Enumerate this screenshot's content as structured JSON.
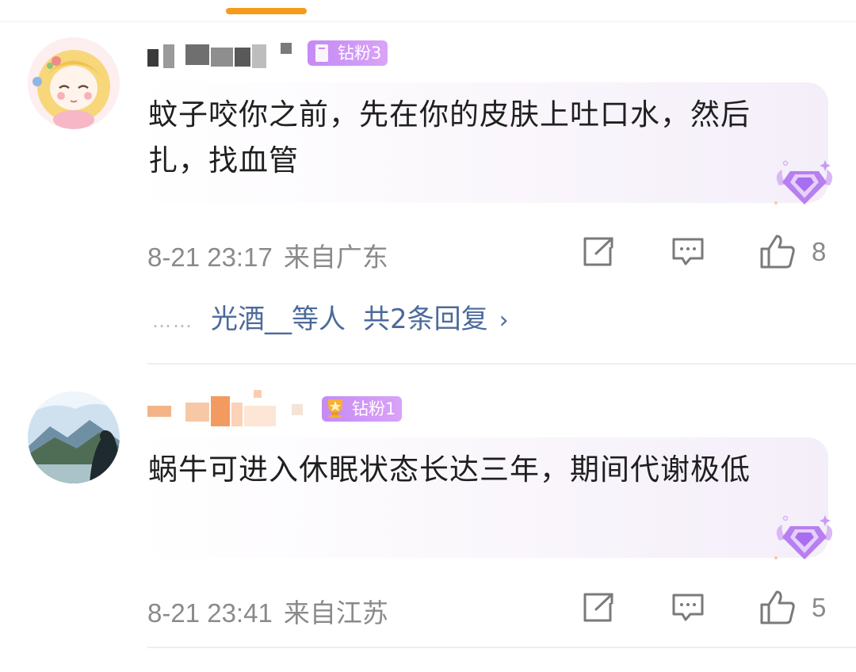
{
  "comments": [
    {
      "badge": "钻粉3",
      "text": "蚊子咬你之前，先在你的皮肤上吐口水，然后扎，找血管",
      "time": "8-21 23:17",
      "location": "来自广东",
      "likes": "8",
      "replies": {
        "dots": "……",
        "names": "光酒__等人",
        "total": "共2条回复",
        "chevron": "›"
      }
    },
    {
      "badge": "钻粉1",
      "text": "蜗牛可进入休眠状态长达三年，期间代谢极低",
      "time": "8-21 23:41",
      "location": "来自江苏",
      "likes": "5"
    }
  ],
  "colors": {
    "accent": "#f79a1b",
    "badge": "#c58af5",
    "link": "#4b6a9b",
    "meta": "#8a8a8a"
  },
  "icons": [
    "share-icon",
    "comment-icon",
    "like-icon",
    "diamond-vip-icon"
  ]
}
